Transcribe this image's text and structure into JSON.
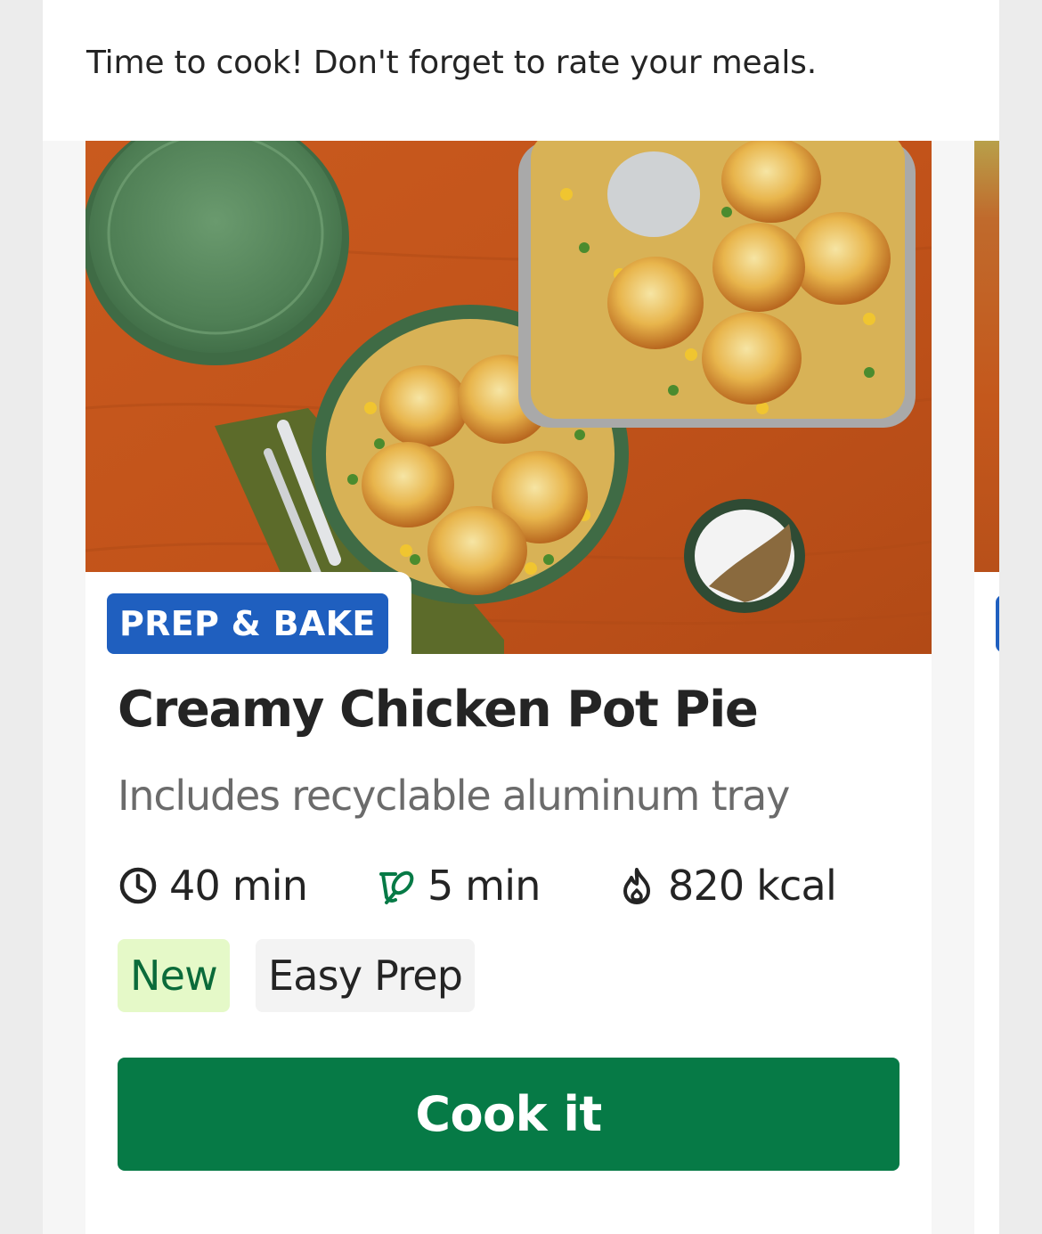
{
  "intro_text": "Time to cook! Don't forget to rate your meals.",
  "meal": {
    "badge": "PREP & BAKE",
    "title": "Creamy Chicken Pot Pie",
    "subtitle": "Includes recyclable aluminum tray",
    "stats": [
      {
        "icon": "clock-icon",
        "value": "40 min"
      },
      {
        "icon": "whisk-icon",
        "value": "5 min"
      },
      {
        "icon": "flame-icon",
        "value": "820 kcal"
      }
    ],
    "tags": [
      "New",
      "Easy Prep"
    ],
    "button_label": "Cook it"
  },
  "colors": {
    "brand_green": "#067a46",
    "badge_blue": "#1f5fbf",
    "new_tag_bg": "#e5f9c8",
    "new_tag_text": "#0b6b3a",
    "tag_bg": "#f3f3f3",
    "text_primary": "#242424",
    "text_secondary": "#6b6b6b"
  }
}
